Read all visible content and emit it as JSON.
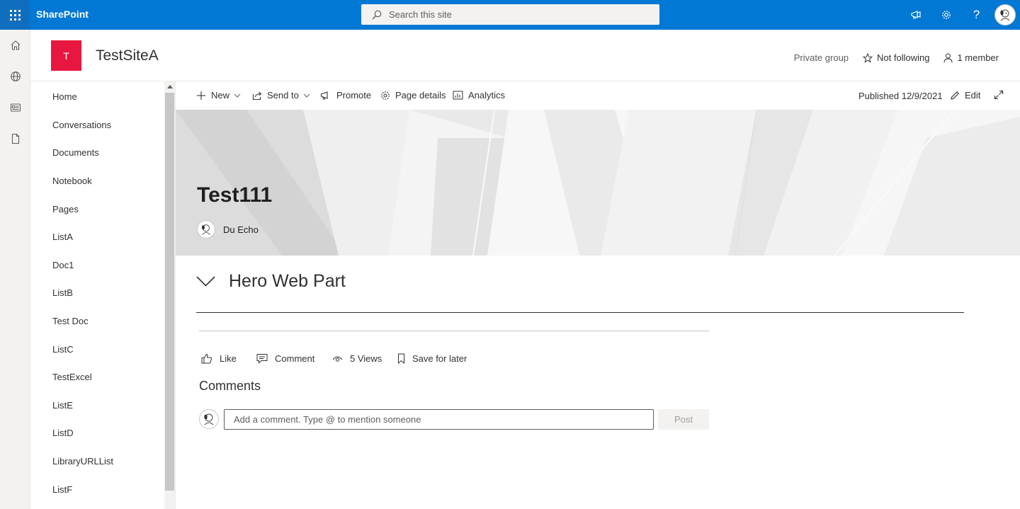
{
  "suitebar": {
    "app_name": "SharePoint",
    "search_placeholder": "Search this site",
    "colors": {
      "background": "#0078d4",
      "waffle": "#106ebe"
    }
  },
  "site": {
    "logo_letter": "T",
    "logo_color": "#e8173f",
    "title": "TestSiteA",
    "privacy": "Private group",
    "follow_label": "Not following",
    "members_label": "1 member"
  },
  "nav": {
    "items": [
      {
        "label": "Home"
      },
      {
        "label": "Conversations"
      },
      {
        "label": "Documents"
      },
      {
        "label": "Notebook"
      },
      {
        "label": "Pages"
      },
      {
        "label": "ListA"
      },
      {
        "label": "Doc1"
      },
      {
        "label": "ListB"
      },
      {
        "label": "Test Doc"
      },
      {
        "label": "ListC"
      },
      {
        "label": "TestExcel"
      },
      {
        "label": "ListE"
      },
      {
        "label": "ListD"
      },
      {
        "label": "LibraryURLList"
      },
      {
        "label": "ListF"
      }
    ]
  },
  "commandbar": {
    "new_label": "New",
    "sendto_label": "Send to",
    "promote_label": "Promote",
    "page_details_label": "Page details",
    "analytics_label": "Analytics",
    "published": "Published 12/9/2021",
    "edit_label": "Edit"
  },
  "page": {
    "title": "Test111",
    "author": "Du Echo",
    "webpart_title": "Hero Web Part"
  },
  "social": {
    "like_label": "Like",
    "comment_label": "Comment",
    "views_label": "5 Views",
    "save_label": "Save for later"
  },
  "comments": {
    "heading": "Comments",
    "placeholder": "Add a comment. Type @ to mention someone",
    "post_label": "Post"
  }
}
